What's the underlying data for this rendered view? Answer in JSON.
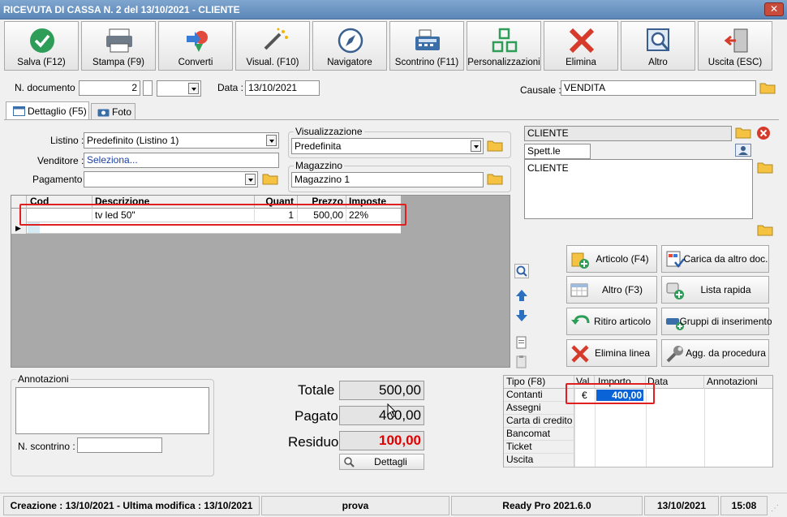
{
  "window": {
    "title": "RICEVUTA DI CASSA N. 2 del 13/10/2021 - CLIENTE",
    "close_glyph": "✕"
  },
  "toolbar": {
    "buttons": [
      {
        "label": "Salva (F12)",
        "icon": "save-check-icon"
      },
      {
        "label": "Stampa (F9)",
        "icon": "printer-icon"
      },
      {
        "label": "Converti",
        "icon": "convert-icon"
      },
      {
        "label": "Visual. (F10)",
        "icon": "magic-wand-icon"
      },
      {
        "label": "Navigatore",
        "icon": "compass-icon"
      },
      {
        "label": "Scontrino (F11)",
        "icon": "cash-register-icon"
      },
      {
        "label": "Personalizzazioni",
        "icon": "customize-grid-icon"
      },
      {
        "label": "Elimina",
        "icon": "delete-x-icon"
      },
      {
        "label": "Altro",
        "icon": "magnifier-icon"
      },
      {
        "label": "Uscita (ESC)",
        "icon": "exit-door-icon"
      }
    ]
  },
  "header": {
    "doc_number_label": "N. documento :",
    "doc_number_value": "2",
    "date_label": "Data :",
    "date_value": "13/10/2021",
    "causale_label": "Causale :",
    "causale_value": "VENDITA"
  },
  "tabs": [
    {
      "label": "Dettaglio (F5)"
    },
    {
      "label": "Foto"
    }
  ],
  "form": {
    "listino_label": "Listino :",
    "listino_value": "Predefinito (Listino 1)",
    "venditore_label": "Venditore :",
    "venditore_value": "Seleziona...",
    "pagamento_label": "Pagamento :",
    "pagamento_value": "",
    "visualizzazione_label": "Visualizzazione",
    "visualizzazione_value": "Predefinita",
    "magazzino_label": "Magazzino",
    "magazzino_value": "Magazzino 1"
  },
  "customer": {
    "name": "CLIENTE",
    "title": "Spett.le",
    "address": "CLIENTE"
  },
  "grid": {
    "columns": [
      "Cod",
      "Descrizione",
      "Quant",
      "Prezzo",
      "Imposte"
    ],
    "rows": [
      {
        "cod": "",
        "descrizione": "tv led 50\"",
        "quant": "1",
        "prezzo": "500,00",
        "imposte": "22%"
      }
    ],
    "highlight_color": "#e02020"
  },
  "actions": [
    {
      "label": "Articolo (F4)",
      "icon": "add-article-icon"
    },
    {
      "label": "Carica da altro doc.",
      "icon": "load-document-icon"
    },
    {
      "label": "Altro (F3)",
      "icon": "table-add-icon"
    },
    {
      "label": "Lista rapida",
      "icon": "quick-list-icon"
    },
    {
      "label": "Ritiro articolo",
      "icon": "return-arrow-icon"
    },
    {
      "label": "Gruppi di inserimento",
      "icon": "insert-group-icon"
    },
    {
      "label": "Elimina linea",
      "icon": "delete-x-icon"
    },
    {
      "label": "Agg. da procedura",
      "icon": "wrench-icon"
    }
  ],
  "notes": {
    "annotazioni_label": "Annotazioni",
    "scontrino_label": "N. scontrino :",
    "scontrino_value": ""
  },
  "totals": {
    "totale_label": "Totale",
    "totale_value": "500,00",
    "pagato_label": "Pagato",
    "pagato_value": "400,00",
    "residuo_label": "Residuo",
    "residuo_value": "100,00",
    "residuo_color": "#e00000",
    "dettagli_label": "Dettagli"
  },
  "payments": {
    "columns": [
      "Tipo (F8)",
      "Val.",
      "Importo",
      "Data",
      "Annotazioni"
    ],
    "types": [
      "Contanti",
      "Assegni",
      "Carta di credito",
      "Bancomat",
      "Ticket",
      "Uscita"
    ],
    "contanti_currency": "€",
    "contanti_amount": "400,00",
    "selection_color": "#0a64d8"
  },
  "status": {
    "creation": "Creazione : 13/10/2021 - Ultima modifica : 13/10/2021",
    "user": "prova",
    "version": "Ready Pro 2021.6.0",
    "date": "13/10/2021",
    "time": "15:08"
  }
}
